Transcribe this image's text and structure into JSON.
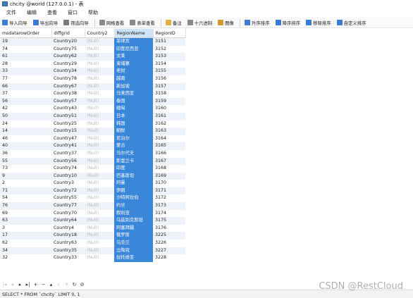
{
  "window": {
    "title": "chcity @world (127.0.0.1) - 表"
  },
  "menu": [
    "文件",
    "编辑",
    "查看",
    "窗口",
    "帮助"
  ],
  "toolbar": [
    {
      "label": "导入向导",
      "icon": "import-wizard-icon",
      "color": "#3a7bd5"
    },
    {
      "label": "导出向导",
      "icon": "export-wizard-icon",
      "color": "#3a7bd5"
    },
    {
      "label": "筛选向导",
      "icon": "filter-icon",
      "color": "#7a7a7a"
    },
    {
      "label": "网格查看",
      "icon": "grid-view-icon",
      "color": "#8a8a8a"
    },
    {
      "label": "表单查看",
      "icon": "form-view-icon",
      "color": "#8a8a8a"
    },
    {
      "label": "备注",
      "icon": "note-icon",
      "color": "#e0b23a"
    },
    {
      "label": "十六进制",
      "icon": "hex-icon",
      "color": "#8a8a8a"
    },
    {
      "label": "图像",
      "icon": "image-icon",
      "color": "#d49a2b"
    },
    {
      "label": "升序排序",
      "icon": "sort-ascending-icon",
      "color": "#3a7bd5"
    },
    {
      "label": "降序排序",
      "icon": "sort-descending-icon",
      "color": "#3a7bd5"
    },
    {
      "label": "移除排序",
      "icon": "remove-sort-icon",
      "color": "#3a7bd5"
    },
    {
      "label": "自定义排序",
      "icon": "custom-sort-icon",
      "color": "#3a7bd5"
    }
  ],
  "grid": {
    "columns": [
      "msdatarowOrder",
      "diffgrid",
      "Country2",
      "RegionName",
      "RegionID"
    ],
    "selected_column": 3,
    "rows": [
      [
        "19",
        "Country20",
        "(Null)",
        "菲律宾",
        "3151"
      ],
      [
        "74",
        "Country75",
        "(Null)",
        "印度尼西亚",
        "3152"
      ],
      [
        "61",
        "Country62",
        "(Null)",
        "文莱",
        "3153"
      ],
      [
        "28",
        "Country29",
        "(Null)",
        "柬埔寨",
        "3154"
      ],
      [
        "33",
        "Country34",
        "(Null)",
        "老挝",
        "3155"
      ],
      [
        "77",
        "Country78",
        "(Null)",
        "越南",
        "3156"
      ],
      [
        "66",
        "Country67",
        "(Null)",
        "新加坡",
        "3157"
      ],
      [
        "37",
        "Country38",
        "(Null)",
        "马来西亚",
        "3158"
      ],
      [
        "56",
        "Country57",
        "(Null)",
        "泰国",
        "3159"
      ],
      [
        "42",
        "Country43",
        "(Null)",
        "缅甸",
        "3160"
      ],
      [
        "50",
        "Country51",
        "(Null)",
        "日本",
        "3161"
      ],
      [
        "24",
        "Country25",
        "(Null)",
        "韩国",
        "3162"
      ],
      [
        "14",
        "Country15",
        "(Null)",
        "朝鲜",
        "3163"
      ],
      [
        "46",
        "Country47",
        "(Null)",
        "尼泊尔",
        "3164"
      ],
      [
        "40",
        "Country41",
        "(Null)",
        "蒙古",
        "3165"
      ],
      [
        "36",
        "Country37",
        "(Null)",
        "马尔代夫",
        "3166"
      ],
      [
        "55",
        "Country56",
        "(Null)",
        "斯里兰卡",
        "3167"
      ],
      [
        "73",
        "Country74",
        "(Null)",
        "印度",
        "3168"
      ],
      [
        "9",
        "Country10",
        "(Null)",
        "巴基斯坦",
        "3169"
      ],
      [
        "2",
        "Country3",
        "(Null)",
        "阿曼",
        "3170"
      ],
      [
        "71",
        "Country72",
        "(Null)",
        "伊朗",
        "3171"
      ],
      [
        "54",
        "Country55",
        "(Null)",
        "沙特阿拉伯",
        "3172"
      ],
      [
        "76",
        "Country77",
        "(Null)",
        "约旦",
        "3173"
      ],
      [
        "69",
        "Country70",
        "(Null)",
        "叙利亚",
        "3174"
      ],
      [
        "63",
        "Country64",
        "(Null)",
        "乌兹别克斯坦",
        "3175"
      ],
      [
        "3",
        "Country4",
        "(Null)",
        "阿塞拜疆",
        "3176"
      ],
      [
        "17",
        "Country18",
        "(Null)",
        "俄罗斯",
        "3225"
      ],
      [
        "62",
        "Country63",
        "(Null)",
        "乌克兰",
        "3226"
      ],
      [
        "34",
        "Country35",
        "(Null)",
        "立陶宛",
        "3227"
      ],
      [
        "32",
        "Country33",
        "(Null)",
        "拉托维亚",
        "3228"
      ]
    ]
  },
  "nav": [
    {
      "glyph": "|◂",
      "name": "first-record-button",
      "dim": true
    },
    {
      "glyph": "◂",
      "name": "prev-record-button",
      "dim": true
    },
    {
      "glyph": "▸",
      "name": "next-record-button",
      "dim": false
    },
    {
      "glyph": "▸|",
      "name": "last-record-button",
      "dim": false
    },
    {
      "glyph": "+",
      "name": "add-record-button",
      "dim": false
    },
    {
      "glyph": "−",
      "name": "delete-record-button",
      "dim": false
    },
    {
      "glyph": "▴",
      "name": "move-up-button",
      "dim": false
    },
    {
      "glyph": "✓",
      "name": "apply-changes-button",
      "dim": true
    },
    {
      "glyph": "✕",
      "name": "discard-changes-button",
      "dim": true
    },
    {
      "glyph": "↻",
      "name": "refresh-button",
      "dim": false
    },
    {
      "glyph": "⊘",
      "name": "stop-button",
      "dim": false
    }
  ],
  "status": {
    "sql": "SELECT * FROM `chcity` LIMIT 0, 1"
  },
  "watermark": "CSDN @RestCloud"
}
